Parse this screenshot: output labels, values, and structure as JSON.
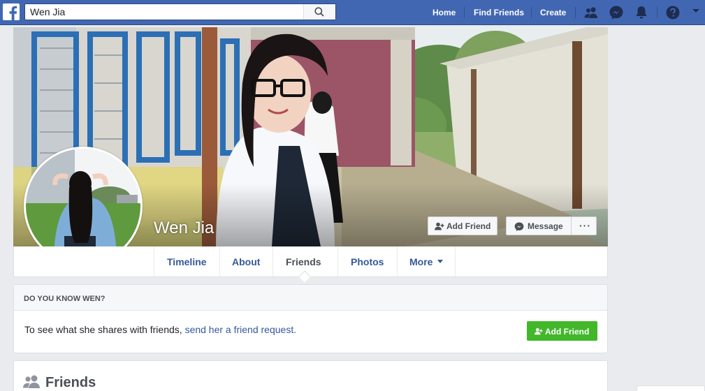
{
  "header": {
    "search_value": "Wen Jia",
    "nav": {
      "home": "Home",
      "find_friends": "Find Friends",
      "create": "Create"
    },
    "icons": [
      "friend-requests-icon",
      "messenger-icon",
      "notifications-icon",
      "help-icon",
      "account-menu-icon"
    ]
  },
  "profile": {
    "name": "Wen Jia",
    "cover_buttons": {
      "add_friend": "Add Friend",
      "message": "Message",
      "more": "···"
    }
  },
  "tabs": [
    {
      "label": "Timeline"
    },
    {
      "label": "About"
    },
    {
      "label": "Friends",
      "active": true
    },
    {
      "label": "Photos"
    },
    {
      "label": "More"
    }
  ],
  "know_card": {
    "heading": "DO YOU KNOW WEN?",
    "text": "To see what she shares with friends,",
    "link": "send her a friend request.",
    "button": "Add Friend"
  },
  "friends_card": {
    "title": "Friends"
  },
  "colors": {
    "brand": "#4267b2",
    "link": "#365899",
    "green": "#42b72a"
  }
}
